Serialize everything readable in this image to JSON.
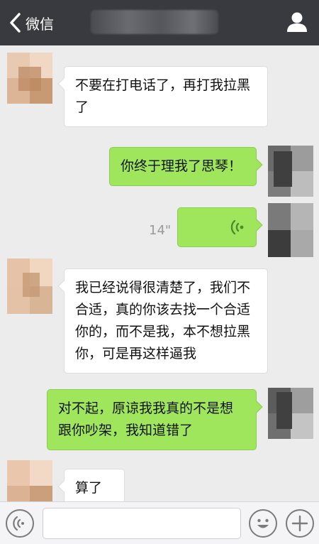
{
  "header": {
    "back_label": "微信",
    "back_icon": "chevron-left-icon",
    "profile_icon": "person-icon"
  },
  "messages": [
    {
      "side": "left",
      "type": "text",
      "text": "不要在打电话了，再打我拉黑\n了"
    },
    {
      "side": "right",
      "type": "text",
      "text": "你终于理我了思琴！"
    },
    {
      "side": "right",
      "type": "voice",
      "duration": "14\"",
      "icon": "voice-wave-icon"
    },
    {
      "side": "left",
      "type": "text",
      "text": "我已经说得很清楚了，我们不\n合适，真的你该去找一个合适\n你的，而不是我，本不想拉黑\n你，可是再这样逼我"
    },
    {
      "side": "right",
      "type": "text",
      "text": "对不起，原谅我我真的不是想\n跟你吵架，我知道错了"
    },
    {
      "side": "left",
      "type": "text",
      "text": "算了吧"
    }
  ],
  "input_bar": {
    "voice_toggle_icon": "voice-mode-icon",
    "text_value": "",
    "emoji_icon": "emoji-icon",
    "more_icon": "plus-icon"
  },
  "colors": {
    "topbar": "#393a3f",
    "chat_bg": "#ececec",
    "bubble_out": "#9fe65c",
    "bubble_in": "#ffffff"
  }
}
